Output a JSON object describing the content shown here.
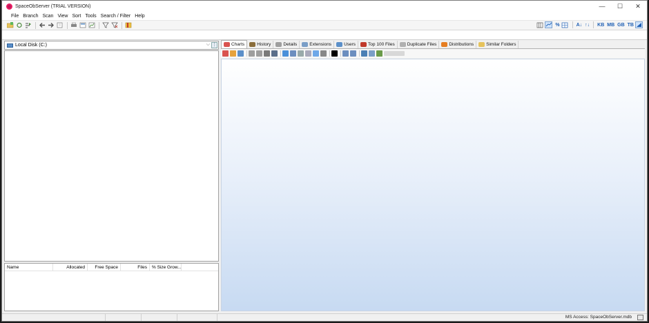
{
  "window": {
    "title": "SpaceObServer  (TRIAL VERSION)"
  },
  "window_controls": {
    "minimize": "—",
    "maximize": "☐",
    "close": "✕"
  },
  "menu": [
    "File",
    "Branch",
    "Scan",
    "View",
    "Sort",
    "Tools",
    "Search / Filter",
    "Help"
  ],
  "toolbar": {
    "left_icons": [
      "open-folder-icon",
      "refresh-icon",
      "scan-branch-icon",
      "back-icon",
      "forward-icon",
      "export-icon",
      "print-icon",
      "report-icon",
      "chart-icon",
      "filter-icon",
      "filter-clear-icon",
      "bookmark-icon"
    ],
    "right_icons": [
      "columns-icon",
      "folder-view-icon",
      "percent-icon",
      "grid-icon",
      "sort-az-icon",
      "sort-size-icon",
      "unit-kb",
      "unit-mb",
      "unit-gb",
      "unit-tb",
      "auto-unit-icon"
    ],
    "percent_symbol": "%",
    "sort_az_symbol": "A↓",
    "sort_size_symbol": "↑↓",
    "units": [
      "KB",
      "MB",
      "GB",
      "TB"
    ]
  },
  "left_panel": {
    "drive": "Local Disk (C:)",
    "drive_arrow": "⌵",
    "list_columns": [
      "Name",
      "Allocated",
      "Free Space",
      "Files",
      "% Size Grow..."
    ]
  },
  "tabs": [
    {
      "label": "Charts",
      "color": "#d9534f",
      "active": true
    },
    {
      "label": "History",
      "color": "#8a6d3b"
    },
    {
      "label": "Details",
      "color": "#9e9e9e"
    },
    {
      "label": "Extensions",
      "color": "#7a9ec7"
    },
    {
      "label": "Users",
      "color": "#5b8fc9"
    },
    {
      "label": "Top 100 Files",
      "color": "#c0392b"
    },
    {
      "label": "Duplicate Files",
      "color": "#b0b0b0"
    },
    {
      "label": "Distributions",
      "color": "#e67e22"
    },
    {
      "label": "Similar Folders",
      "color": "#e6c35c"
    }
  ],
  "chart_toolbar_icons": [
    {
      "name": "pie-chart-icon",
      "color": "#d9534f"
    },
    {
      "name": "bar-chart-icon",
      "color": "#e6a23c"
    },
    {
      "name": "stack-chart-icon",
      "color": "#5b8fc9"
    },
    {
      "name": "copy-icon",
      "color": "#9e9e9e"
    },
    {
      "name": "email-icon",
      "color": "#9e9e9e"
    },
    {
      "name": "print-icon",
      "color": "#7a7a7a"
    },
    {
      "name": "save-icon",
      "color": "#5a6e8a"
    },
    {
      "name": "folders-view-icon",
      "color": "#4a90d9"
    },
    {
      "name": "legend-icon",
      "color": "#6c8ebf"
    },
    {
      "name": "list-icon",
      "color": "#9aa"
    },
    {
      "name": "columns-icon",
      "color": "#aab"
    },
    {
      "name": "gradient-icon",
      "color": "#6fa8e8"
    },
    {
      "name": "bars-icon",
      "color": "#888"
    },
    {
      "name": "color-black-icon",
      "color": "#000000"
    },
    {
      "name": "zoom-in-icon",
      "color": "#6c8ebf"
    },
    {
      "name": "zoom-out-icon",
      "color": "#6c8ebf"
    },
    {
      "name": "details-icon",
      "color": "#4a7fb5"
    },
    {
      "name": "properties-icon",
      "color": "#7a9ec7"
    },
    {
      "name": "users-icon",
      "color": "#6a9a4a"
    },
    {
      "name": "slider-icon",
      "color": "#d8d8d8"
    }
  ],
  "statusbar": {
    "text": "MS Access: SpaceObServer.mdb"
  }
}
